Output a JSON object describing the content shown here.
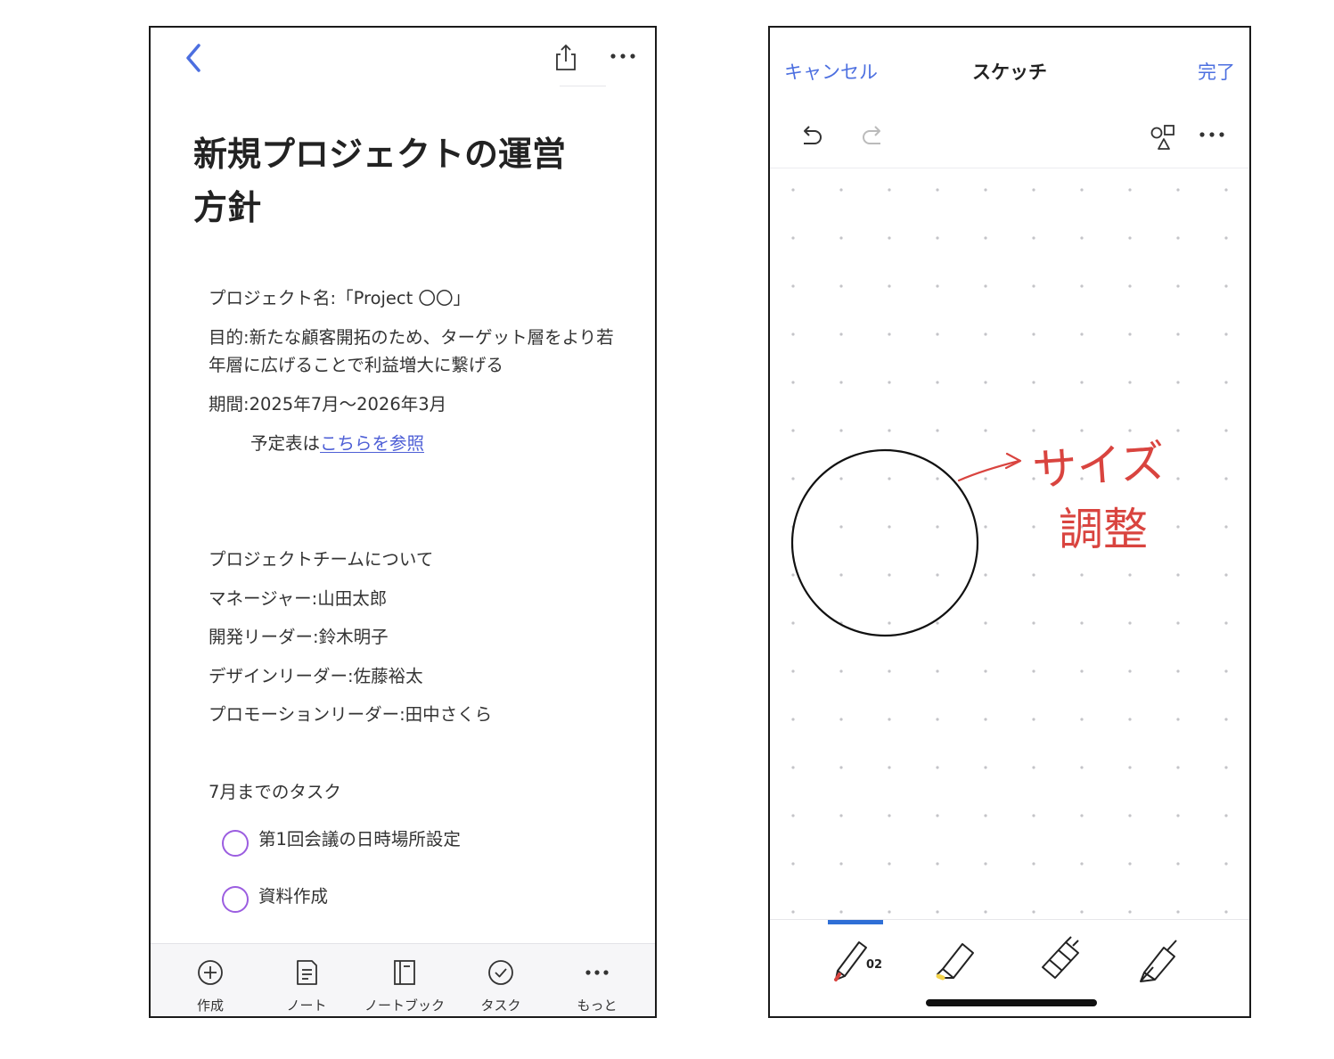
{
  "left_screen": {
    "header": {
      "back_icon": "chevron-left-icon",
      "share_icon": "share-icon",
      "more_icon": "ellipsis-icon"
    },
    "title_line1": "新規プロジェクトの運営",
    "title_line2": "方針",
    "body": {
      "project_name": "プロジェクト名:「Project 〇〇」",
      "purpose": "目的:新たな顧客開拓のため、ターゲット層をより若年層に広げることで利益増大に繋げる",
      "period": "期間:2025年7月〜2026年3月",
      "schedule_prefix": "予定表は",
      "schedule_link": "こちらを参照",
      "team_heading": "プロジェクトチームについて",
      "manager": "マネージャー:山田太郎",
      "dev_leader": "開発リーダー:鈴木明子",
      "design_leader": "デザインリーダー:佐藤裕太",
      "promo_leader": "プロモーションリーダー:田中さくら",
      "tasks_heading": "7月までのタスク",
      "tasks": [
        "第1回会議の日時場所設定",
        "資料作成"
      ]
    },
    "bottom_nav": [
      {
        "label": "作成",
        "icon": "plus-circle-icon"
      },
      {
        "label": "ノート",
        "icon": "note-icon"
      },
      {
        "label": "ノートブック",
        "icon": "notebook-icon"
      },
      {
        "label": "タスク",
        "icon": "check-circle-icon"
      },
      {
        "label": "もっと",
        "icon": "ellipsis-icon"
      }
    ],
    "accent_color": "#4e5fd6",
    "task_circle_color": "#9b5de0"
  },
  "right_screen": {
    "cancel_label": "キャンセル",
    "title": "スケッチ",
    "done_label": "完了",
    "toolbar_icons": [
      "undo-icon",
      "redo-icon",
      "shapes-icon",
      "ellipsis-icon"
    ],
    "canvas": {
      "background": "dot-grid",
      "annotation_line1": "サイズ",
      "annotation_line2": "調整",
      "annotation_color": "#d9443f"
    },
    "pen_size_label": "02",
    "tools": [
      "pen-tool-icon",
      "highlighter-tool-icon",
      "eraser-tool-icon",
      "fountain-pen-tool-icon"
    ],
    "accent_color": "#4c6fe0"
  }
}
